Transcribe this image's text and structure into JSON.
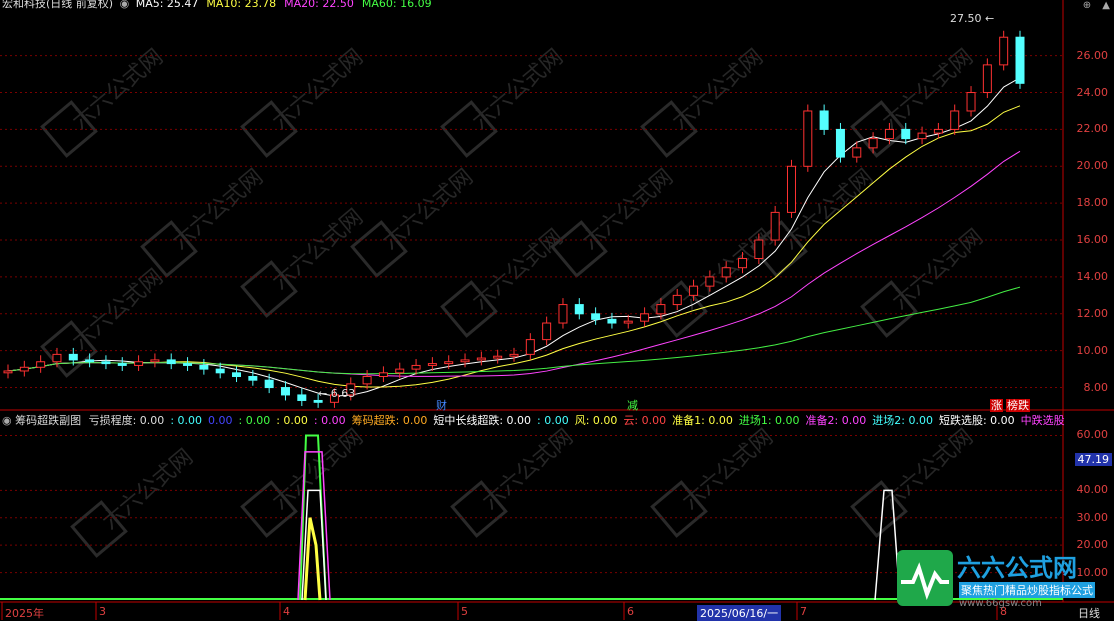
{
  "main_header": {
    "title": "宏和科技(日线 前复权)",
    "ma": [
      {
        "label": "MA5: 25.47",
        "color": "#ffffff"
      },
      {
        "label": "MA10: 23.78",
        "color": "#ffff44"
      },
      {
        "label": "MA20: 22.50",
        "color": "#ff44ff"
      },
      {
        "label": "MA60: 16.09",
        "color": "#44ff44"
      }
    ]
  },
  "main_axis": {
    "ticks": [
      "26.00",
      "24.00",
      "22.00",
      "20.00",
      "18.00",
      "16.00",
      "14.00",
      "12.00",
      "10.00",
      "8.00"
    ]
  },
  "annotations": {
    "high": "27.50",
    "low": "6.63"
  },
  "markers": [
    {
      "text": "财",
      "color": "#4488ff"
    },
    {
      "text": "减",
      "color": "#44ff44"
    },
    {
      "text": "涨",
      "color": "#ff4444"
    },
    {
      "text": "榜跌",
      "color": "#ffffff"
    }
  ],
  "sub_header": {
    "title": "筹码超跌副图",
    "items": [
      {
        "label": "亏损程度: 0.00",
        "color": "#dddddd"
      },
      {
        "label": ": 0.00",
        "color": "#44ffff"
      },
      {
        "label": "0.00",
        "color": "#4444ff"
      },
      {
        "label": ": 0.00",
        "color": "#44ff44"
      },
      {
        "label": ": 0.00",
        "color": "#ffff44"
      },
      {
        "label": ": 0.00",
        "color": "#ff44ff"
      },
      {
        "label": "筹码超跌: 0.00",
        "color": "#ffaa22"
      },
      {
        "label": "短中长线超跌: 0.00",
        "color": "#ffffff"
      },
      {
        "label": ": 0.00",
        "color": "#44ffff"
      },
      {
        "label": "风: 0.00",
        "color": "#ffff44"
      },
      {
        "label": "云: 0.00",
        "color": "#ff4444"
      },
      {
        "label": "准备1: 0.00",
        "color": "#ffff44"
      },
      {
        "label": "进场1: 0.00",
        "color": "#44ff44"
      },
      {
        "label": "准备2: 0.00",
        "color": "#ff44ff"
      },
      {
        "label": "进场2: 0.00",
        "color": "#44ffff"
      },
      {
        "label": "短跌选股: 0.00",
        "color": "#ffffff"
      },
      {
        "label": "中跌选股",
        "color": "#ff44ff"
      }
    ]
  },
  "sub_axis": {
    "ticks": [
      "60.00",
      "40.00",
      "30.00",
      "20.00",
      "10.00"
    ],
    "current": "47.19"
  },
  "x_axis": {
    "labels": [
      "2025年",
      "3",
      "4",
      "5",
      "6",
      "7",
      "8"
    ],
    "cursor": "2025/06/16/一",
    "mode": "日线"
  },
  "watermark": {
    "brand": "六六公式网",
    "slogan": "聚焦热门精品炒股指标公式",
    "url": "www.66gsw.com"
  },
  "chart_data": {
    "type": "candlestick",
    "title": "宏和科技(日线 前复权)",
    "ylim": [
      7,
      27.5
    ],
    "close_approx": [
      8.9,
      9.1,
      9.4,
      9.8,
      9.5,
      9.4,
      9.3,
      9.2,
      9.4,
      9.5,
      9.3,
      9.2,
      9.0,
      8.8,
      8.6,
      8.4,
      8.0,
      7.6,
      7.3,
      7.2,
      7.6,
      8.2,
      8.6,
      8.8,
      9.0,
      9.2,
      9.3,
      9.4,
      9.5,
      9.6,
      9.7,
      9.8,
      10.6,
      11.5,
      12.5,
      12.0,
      11.7,
      11.5,
      11.6,
      12.0,
      12.5,
      13.0,
      13.5,
      14.0,
      14.5,
      15.0,
      16.0,
      17.5,
      20.0,
      23.0,
      22.0,
      20.5,
      21.0,
      21.5,
      22.0,
      21.5,
      21.8,
      22.0,
      23.0,
      24.0,
      25.5,
      27.0,
      24.5
    ],
    "high": 27.5,
    "low": 6.63,
    "ma_last": {
      "MA5": 25.47,
      "MA10": 23.78,
      "MA20": 22.5,
      "MA60": 16.09
    }
  }
}
